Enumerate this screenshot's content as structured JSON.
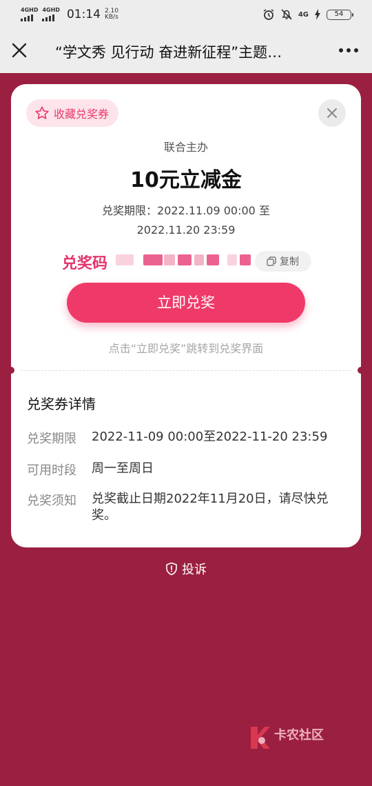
{
  "status_bar": {
    "signal1": "4GHD",
    "signal2": "4GHD",
    "time": "01:14",
    "speed_value": "2.10",
    "speed_unit": "KB/s",
    "net": "4G",
    "battery": "54"
  },
  "navbar": {
    "title": "“学文秀 见行动 奋进新征程”主题…"
  },
  "card": {
    "favorite_label": "收藏兑奖券",
    "sponsor": "联合主办",
    "amount": "10元立减金",
    "period_line1": "兑奖期限：2022.11.09 00:00 至",
    "period_line2": "2022.11.20 23:59",
    "code_label": "兑奖码",
    "copy_label": "复制",
    "redeem_label": "立即兑奖",
    "hint": "点击“立即兑奖”跳转到兑奖界面"
  },
  "details": {
    "title": "兑奖券详情",
    "rows": [
      {
        "key": "兑奖期限",
        "value": "2022-11-09 00:00至2022-11-20 23:59"
      },
      {
        "key": "可用时段",
        "value": "周一至周日"
      },
      {
        "key": "兑奖须知",
        "value": "兑奖截止日期2022年11月20日，请尽快兑奖。"
      }
    ]
  },
  "complain_label": "投诉",
  "watermark": {
    "text": "卡农社区"
  },
  "colors": {
    "background": "#9a1f40",
    "accent": "#ef3a69",
    "favorite_bg": "#fde4ea"
  }
}
